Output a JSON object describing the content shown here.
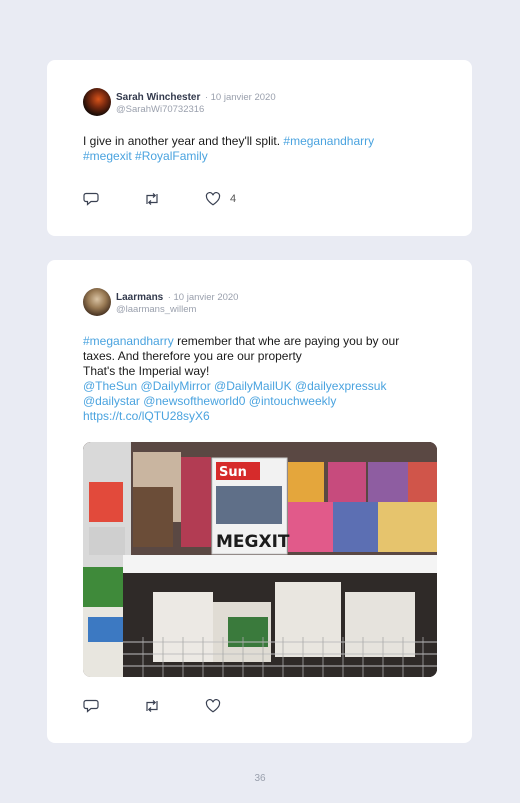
{
  "tweets": [
    {
      "author": "Sarah Winchester",
      "date": "· 10 janvier 2020",
      "handle": "@SarahWi70732316",
      "text_parts": [
        "I give in another year and they'll split. "
      ],
      "tags_line1": "#meganandharry",
      "tags_line2": "#megexit #RoyalFamily",
      "likes": "4"
    },
    {
      "author": "Laarmans",
      "date": "· 10 janvier 2020",
      "handle": "@laarmans_willem",
      "tag_start": "#meganandharry",
      "text_line1": " remember that whe are paying you by our",
      "text_line2": "taxes. And therefore you are our property",
      "text_line3": "That's the Imperial way!",
      "mentions_line1": "@TheSun @DailyMirror @DailyMailUK @dailyexpressuk",
      "mentions_line2": "@dailystar @newsoftheworld0 @intouchweekly",
      "link": "https://t.co/lQTU28syX6",
      "image_headline": "MEGXIT",
      "image_masthead": "Sun"
    }
  ],
  "page_number": "36",
  "colors": {
    "accent": "#4aa3df",
    "background": "#e9ebf3",
    "card": "#ffffff"
  }
}
